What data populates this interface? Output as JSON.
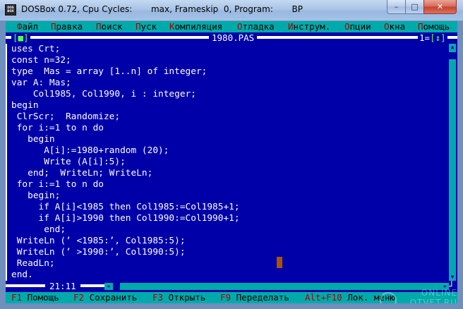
{
  "window": {
    "title": "DOSBox 0.72, Cpu Cycles:       max, Frameskip  0, Program:       BP",
    "icon_text": "DOS BOX",
    "min_glyph": "–",
    "max_glyph": "□",
    "close_glyph": "✕"
  },
  "menu": {
    "items": [
      {
        "hot": "Ф",
        "rest": "айл"
      },
      {
        "hot": "П",
        "rest": "равка"
      },
      {
        "hot": "П",
        "rest": "оиск"
      },
      {
        "hot": "П",
        "rest": "уск"
      },
      {
        "hot": "К",
        "rest": "омпиляция"
      },
      {
        "hot": "О",
        "rest": "тладка"
      },
      {
        "hot": "И",
        "rest": "нструм."
      },
      {
        "hot": "О",
        "rest": "пции"
      },
      {
        "hot": "О",
        "rest": "кна"
      },
      {
        "hot": "П",
        "rest": "омощь"
      }
    ]
  },
  "editor": {
    "file_name": "1980.PAS",
    "close_button": "[■]",
    "window_number": "1",
    "zoom_button": "[↕]",
    "cursor_position": "21:11",
    "code_lines": [
      "uses Crt;",
      "const n=32;",
      "type  Mas = array [1..n] of integer;",
      "var A: Mas;",
      "    Col1985, Col1990, i : integer;",
      "begin",
      " ClrScr;  Randomize;",
      " for i:=1 to n do",
      "   begin",
      "      A[i]:=1980+random (20);",
      "      Write (A[i]:5);",
      "   end;  WriteLn; WriteLn;",
      " for i:=1 to n do",
      "   begin;",
      "     if A[i]<1985 then Col1985:=Col1985+1;",
      "     if A[i]>1990 then Col1990:=Col1990+1;",
      "      end;",
      " WriteLn (’ <1985:’, Col1985:5);",
      " WriteLn (’ >1990:’, Col1990:5);",
      " ReadLn;",
      "end."
    ]
  },
  "statusbar": {
    "items": [
      {
        "key": "F1",
        "label": " Помощь"
      },
      {
        "key": "F2",
        "label": " Сохранить"
      },
      {
        "key": "F3",
        "label": " Открыть"
      },
      {
        "key": "F9",
        "label": " Переделать"
      },
      {
        "key": "Alt+F10",
        "label": " Лок. меню"
      }
    ]
  },
  "watermark": {
    "line1": "ONLINE",
    "line2": "OTVET.RU"
  },
  "colors": {
    "screen_bg": "#0000a8",
    "menu_bg": "#00aaaa",
    "hotkey": "#a80000",
    "cursor": "#a85400"
  }
}
